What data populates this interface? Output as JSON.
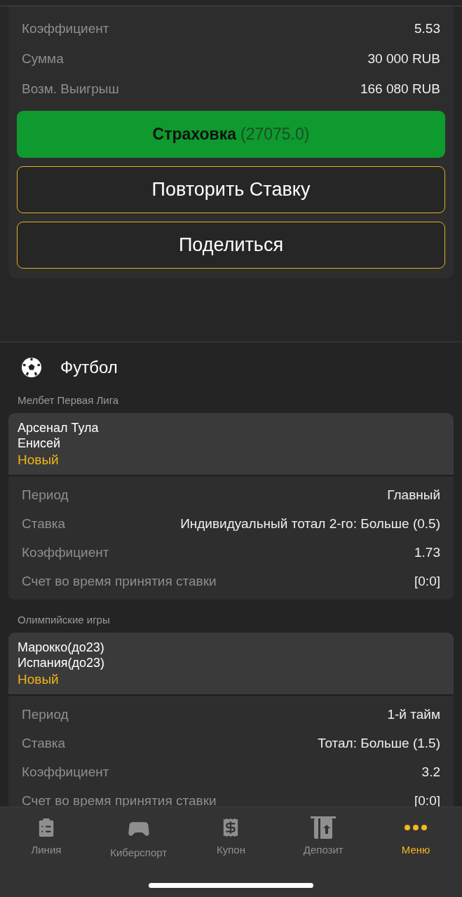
{
  "summary": {
    "rows": [
      {
        "label": "Коэффициент",
        "value": "5.53"
      },
      {
        "label": "Сумма",
        "value": "30 000 RUB"
      },
      {
        "label": "Возм. Выигрыш",
        "value": "166 080 RUB"
      }
    ],
    "buttons": [
      {
        "kind": "insurance",
        "label": "Страховка",
        "amount": "(27075.0)"
      },
      {
        "kind": "outline",
        "label": "Повторить Ставку"
      },
      {
        "kind": "outline",
        "label": "Поделиться"
      }
    ]
  },
  "sport": {
    "title": "Футбол",
    "leagues": [
      {
        "name": "Мелбет Первая Лига",
        "match": {
          "team_1": "Арсенал Тула",
          "team_2": "Енисей",
          "status": "Новый"
        },
        "details": [
          {
            "label": "Период",
            "value": "Главный"
          },
          {
            "label": "Ставка",
            "value": "Индивидуальный тотал 2-го: Больше (0.5)"
          },
          {
            "label": "Коэффициент",
            "value": "1.73"
          },
          {
            "label": "Счет во время принятия ставки",
            "value": "[0:0]"
          }
        ]
      },
      {
        "name": "Олимпийские игры",
        "match": {
          "team_1": "Марокко(до23)",
          "team_2": "Испания(до23)",
          "status": "Новый"
        },
        "details": [
          {
            "label": "Период",
            "value": "1-й тайм"
          },
          {
            "label": "Ставка",
            "value": "Тотал: Больше (1.5)"
          },
          {
            "label": "Коэффициент",
            "value": "3.2"
          },
          {
            "label": "Счет во время принятия ставки",
            "value": "[0:0]"
          }
        ]
      }
    ]
  },
  "nav": [
    {
      "label": "Линия",
      "kind": "line",
      "selected": false
    },
    {
      "label": "Киберспорт",
      "kind": "esports",
      "selected": false
    },
    {
      "label": "Купон",
      "kind": "coupon",
      "selected": false
    },
    {
      "label": "Депозит",
      "kind": "deposit",
      "selected": false
    },
    {
      "label": "Меню",
      "kind": "menu",
      "selected": true
    }
  ]
}
